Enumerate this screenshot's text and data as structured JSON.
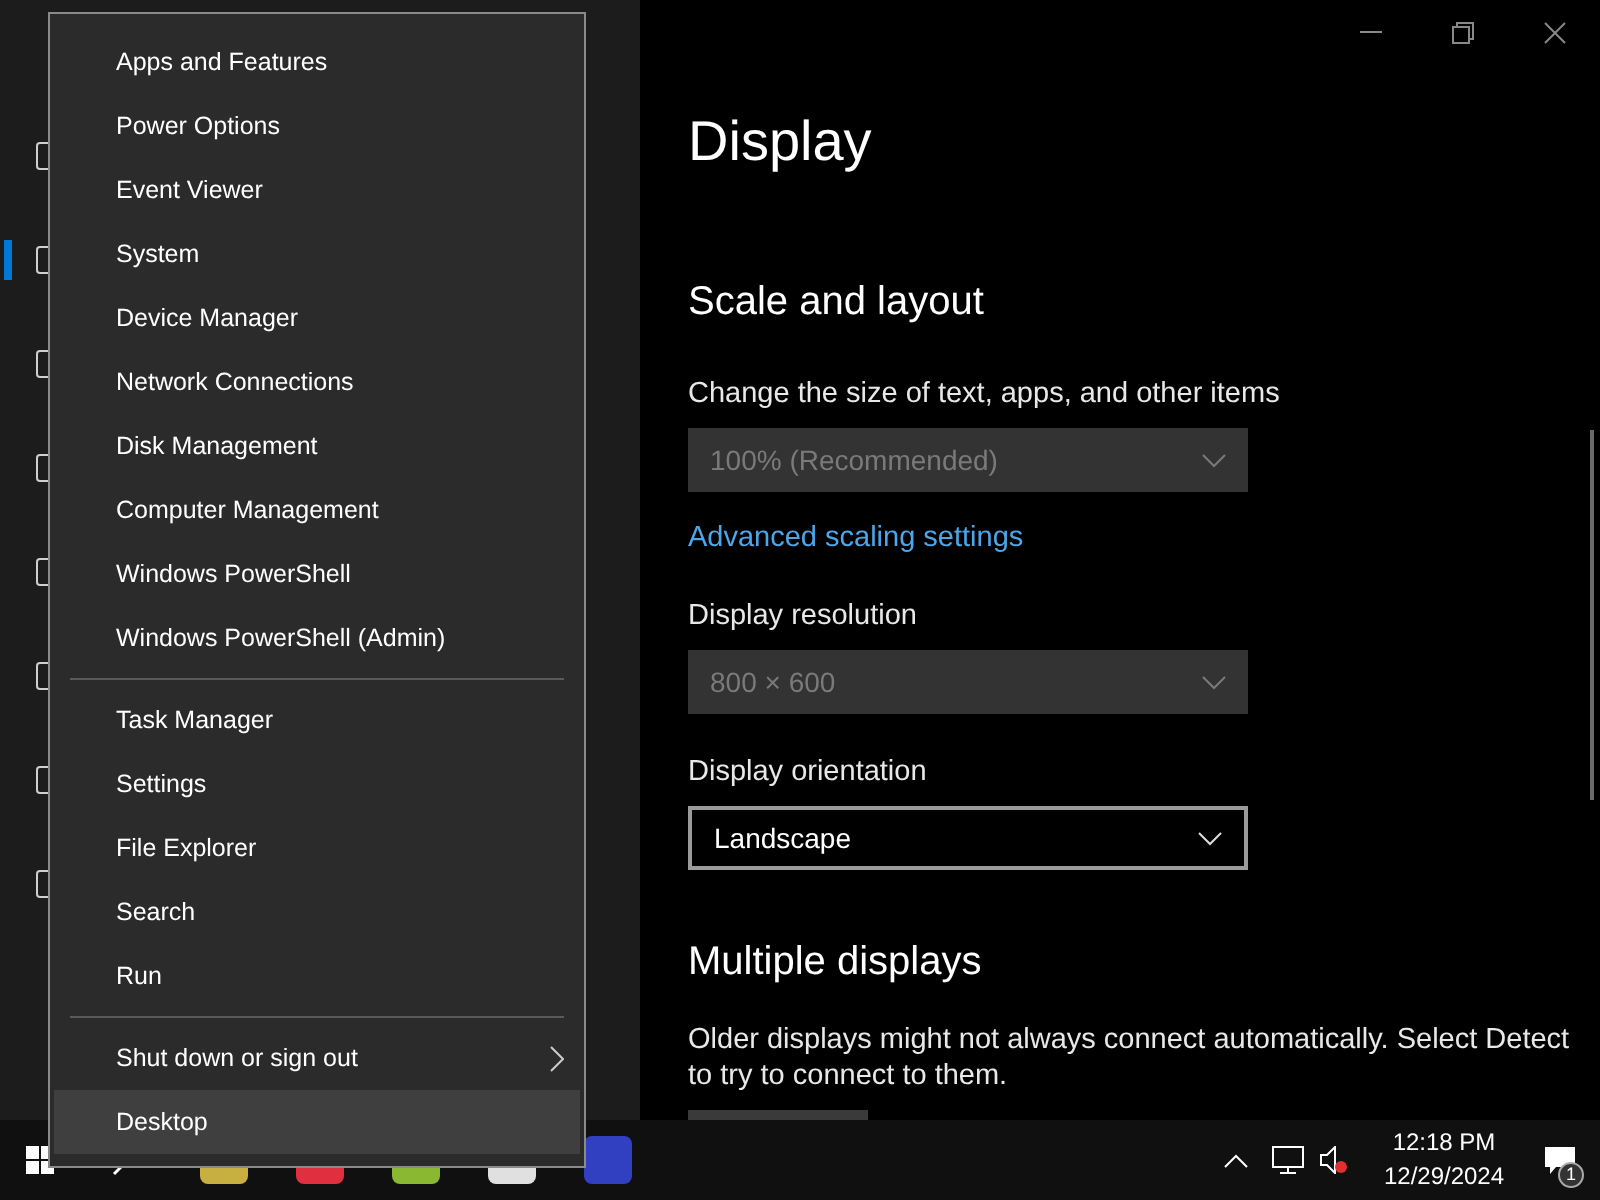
{
  "window": {
    "controls": [
      {
        "kind": "minimize"
      },
      {
        "kind": "restore"
      },
      {
        "kind": "close"
      }
    ]
  },
  "sidebar": {
    "items": [
      {
        "selected": false
      },
      {
        "selected": true
      },
      {
        "selected": false
      },
      {
        "selected": false
      },
      {
        "selected": false
      },
      {
        "selected": false
      },
      {
        "selected": false
      },
      {
        "selected": false
      }
    ]
  },
  "content": {
    "title": "Display",
    "section_title": "Scale and layout",
    "scale": {
      "label": "Change the size of text, apps, and other items",
      "value": "100% (Recommended)",
      "disabled": true
    },
    "link": "Advanced scaling settings",
    "resolution": {
      "label": "Display resolution",
      "value": "800 × 600",
      "disabled": true
    },
    "orientation": {
      "label": "Display orientation",
      "value": "Landscape",
      "disabled": false
    },
    "multiple_title": "Multiple displays",
    "multiple_text": "Older displays might not always connect automatically. Select Detect to try to connect to them."
  },
  "menu": {
    "items": [
      {
        "kind": "item",
        "label": "Apps and Features",
        "selected": false
      },
      {
        "kind": "item",
        "label": "Power Options",
        "selected": false
      },
      {
        "kind": "item",
        "label": "Event Viewer",
        "selected": false
      },
      {
        "kind": "item",
        "label": "System",
        "selected": false
      },
      {
        "kind": "item",
        "label": "Device Manager",
        "selected": false
      },
      {
        "kind": "item",
        "label": "Network Connections",
        "selected": false
      },
      {
        "kind": "item",
        "label": "Disk Management",
        "selected": false
      },
      {
        "kind": "item",
        "label": "Computer Management",
        "selected": false
      },
      {
        "kind": "item",
        "label": "Windows PowerShell",
        "selected": false
      },
      {
        "kind": "item",
        "label": "Windows PowerShell (Admin)",
        "selected": false
      },
      {
        "kind": "separator"
      },
      {
        "kind": "item",
        "label": "Task Manager",
        "selected": false
      },
      {
        "kind": "item",
        "label": "Settings",
        "selected": false
      },
      {
        "kind": "item",
        "label": "File Explorer",
        "selected": false
      },
      {
        "kind": "item",
        "label": "Search",
        "selected": false
      },
      {
        "kind": "item",
        "label": "Run",
        "selected": false
      },
      {
        "kind": "separator"
      },
      {
        "kind": "submenu",
        "label": "Shut down or sign out",
        "selected": false
      },
      {
        "kind": "item",
        "label": "Desktop",
        "selected": true
      }
    ]
  },
  "taskbar": {
    "apps": [
      {
        "color": "#c8b040"
      },
      {
        "color": "#e03040"
      },
      {
        "color": "#8ab830"
      },
      {
        "color": "#e0e0e0"
      },
      {
        "color": "#3040c0"
      }
    ],
    "time": "12:18 PM",
    "date": "12/29/2024",
    "notification_count": "1"
  }
}
